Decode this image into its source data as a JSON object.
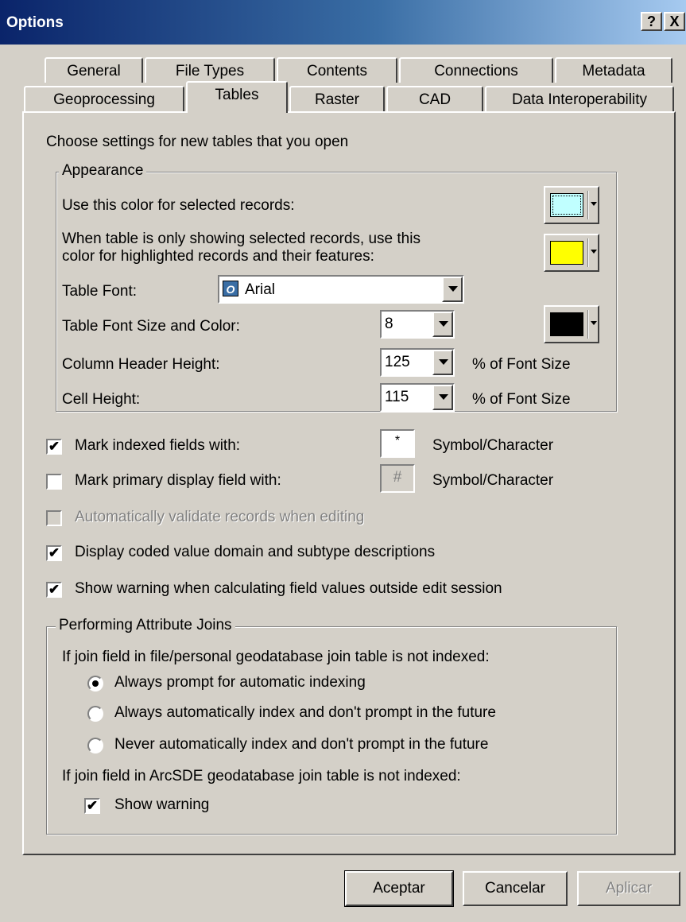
{
  "window": {
    "title": "Options",
    "help_btn": "?",
    "close_btn": "X"
  },
  "tabs_row1": [
    "General",
    "File Types",
    "Contents",
    "Connections",
    "Metadata"
  ],
  "tabs_row2": [
    "Geoprocessing",
    "Tables",
    "Raster",
    "CAD",
    "Data Interoperability"
  ],
  "active_tab": "Tables",
  "intro": "Choose settings for new tables that you open",
  "appearance": {
    "legend": "Appearance",
    "selected_color_label": "Use this color for selected records:",
    "highlight_label_line1": "When table is only showing selected records, use this",
    "highlight_label_line2": "color for highlighted records and their features:",
    "font_label": "Table Font:",
    "font_value": "Arial",
    "font_size_label": "Table Font Size and Color:",
    "font_size_value": "8",
    "header_height_label": "Column Header Height:",
    "header_height_value": "125",
    "cell_height_label": "Cell Height:",
    "cell_height_value": "115",
    "pct_label": "% of Font Size",
    "colors": {
      "selected": "#c0ffff",
      "highlight": "#ffff00",
      "font": "#000000"
    }
  },
  "options": {
    "indexed_label": "Mark indexed fields with:",
    "indexed_value": "*",
    "primary_label": "Mark primary display field with:",
    "primary_value": "#",
    "symbol_label": "Symbol/Character",
    "validate_label": "Automatically validate records when editing",
    "coded_label": "Display coded value domain and subtype descriptions",
    "warning_label": "Show warning when calculating field values outside edit session",
    "check": "✔"
  },
  "joins": {
    "legend": "Performing Attribute Joins",
    "file_heading": "If join field in file/personal geodatabase join table is not indexed:",
    "radio1": "Always prompt for automatic indexing",
    "radio2": "Always automatically index and don't prompt in the future",
    "radio3": "Never automatically index and don't prompt in the future",
    "sde_heading": "If join field in ArcSDE geodatabase join table is not indexed:",
    "show_warning": "Show warning"
  },
  "buttons": {
    "ok": "Aceptar",
    "cancel": "Cancelar",
    "apply": "Aplicar"
  }
}
